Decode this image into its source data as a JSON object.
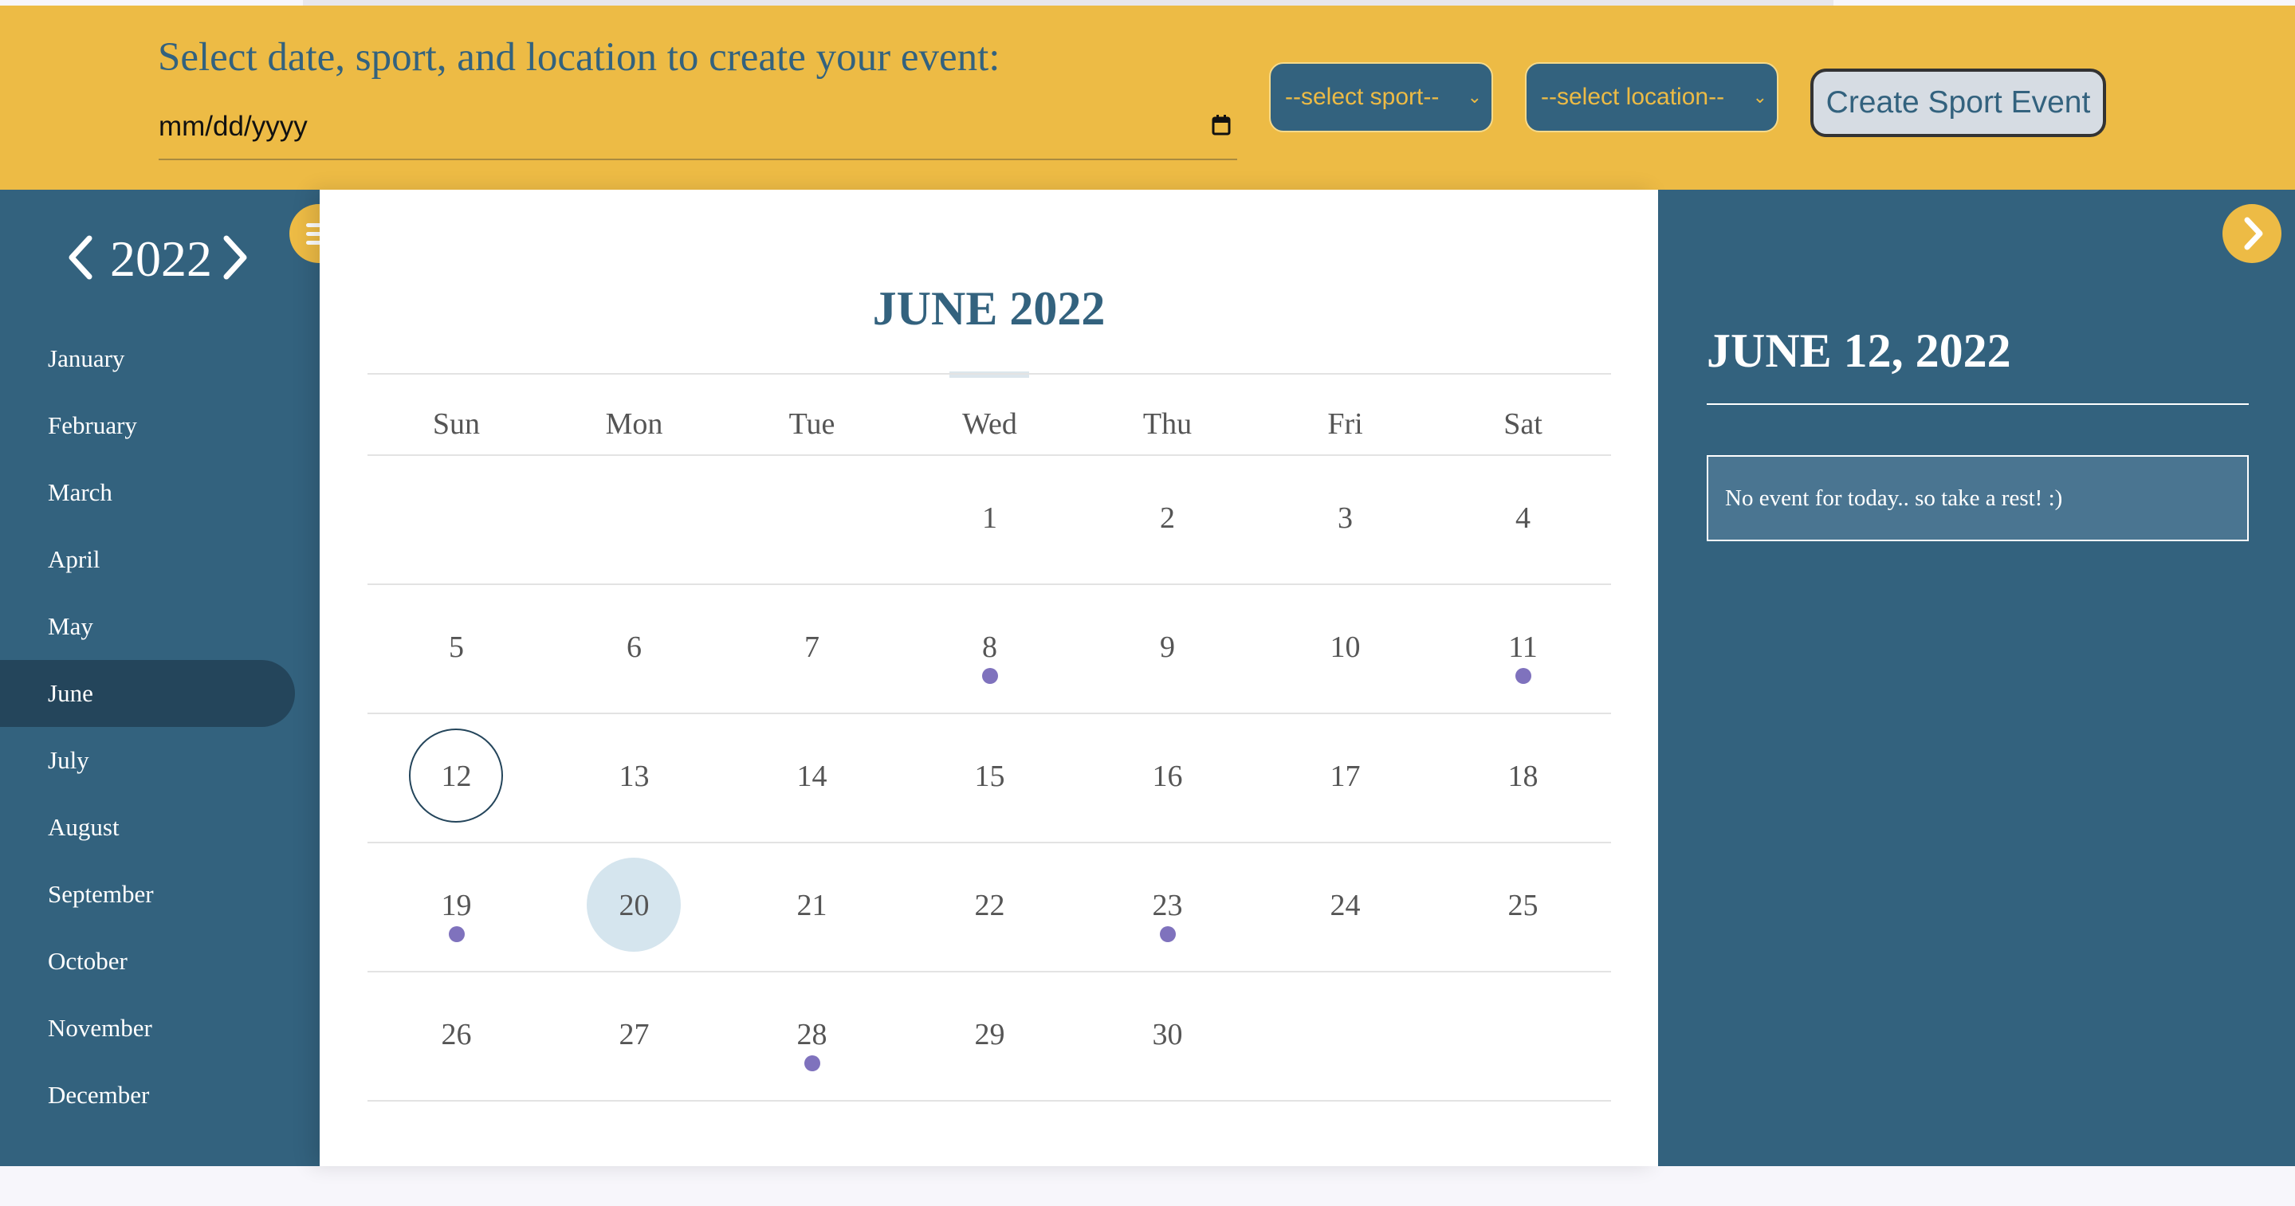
{
  "header": {
    "prompt": "Select date, sport, and location to create your event:",
    "date_placeholder": "mm/dd/yyyy",
    "sport_select": "--select sport--",
    "location_select": "--select location--",
    "create_button": "Create Sport Event"
  },
  "sidebar": {
    "year": "2022",
    "months": [
      "January",
      "February",
      "March",
      "April",
      "May",
      "June",
      "July",
      "August",
      "September",
      "October",
      "November",
      "December"
    ],
    "active_month": "June"
  },
  "calendar": {
    "title": "JUNE 2022",
    "weekdays": [
      "Sun",
      "Mon",
      "Tue",
      "Wed",
      "Thu",
      "Fri",
      "Sat"
    ],
    "weeks": [
      [
        "",
        "",
        "",
        "1",
        "2",
        "3",
        "4"
      ],
      [
        "5",
        "6",
        "7",
        "8",
        "9",
        "10",
        "11"
      ],
      [
        "12",
        "13",
        "14",
        "15",
        "16",
        "17",
        "18"
      ],
      [
        "19",
        "20",
        "21",
        "22",
        "23",
        "24",
        "25"
      ],
      [
        "26",
        "27",
        "28",
        "29",
        "30",
        "",
        ""
      ]
    ],
    "event_days": [
      "8",
      "11",
      "19",
      "23",
      "28"
    ],
    "today": "12",
    "highlighted": "20"
  },
  "detail": {
    "date": "JUNE 12, 2022",
    "message": "No event for today.. so take a rest! :)"
  },
  "colors": {
    "header_bg": "#edbb45",
    "panel_bg": "#33627e",
    "active_month_bg": "#24455b",
    "event_dot": "#7f72bd",
    "highlight_day": "#d5e5ee"
  },
  "icons": {
    "menu": "hamburger-menu-icon",
    "next": "chevron-right-icon",
    "prev_year": "chevron-left-icon",
    "next_year": "chevron-right-icon",
    "calendar_picker": "calendar-icon"
  }
}
